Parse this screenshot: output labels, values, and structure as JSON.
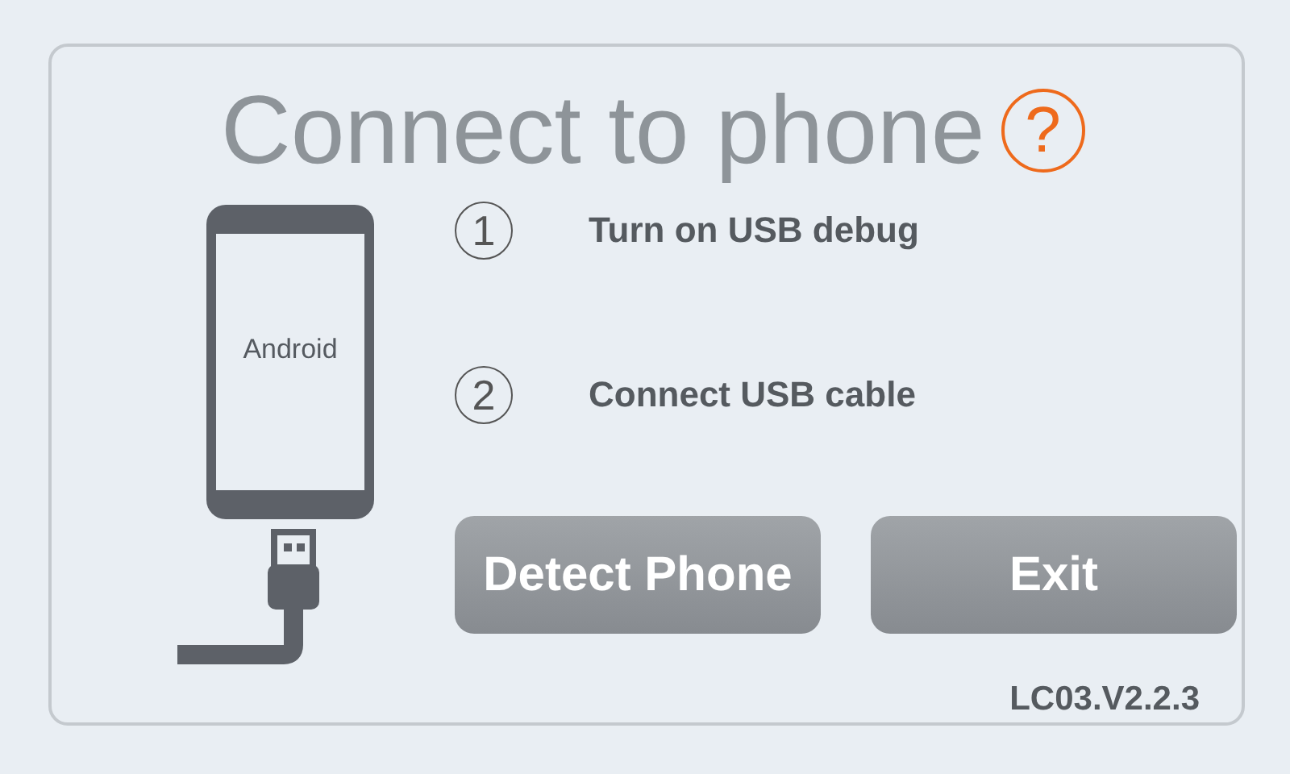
{
  "title": "Connect to phone",
  "help": "?",
  "phone_label": "Android",
  "steps": [
    {
      "number": "1",
      "text": "Turn on USB debug"
    },
    {
      "number": "2",
      "text": "Connect USB cable"
    }
  ],
  "buttons": [
    "Detect Phone",
    "Exit"
  ],
  "version": "LC03.V2.2.3"
}
